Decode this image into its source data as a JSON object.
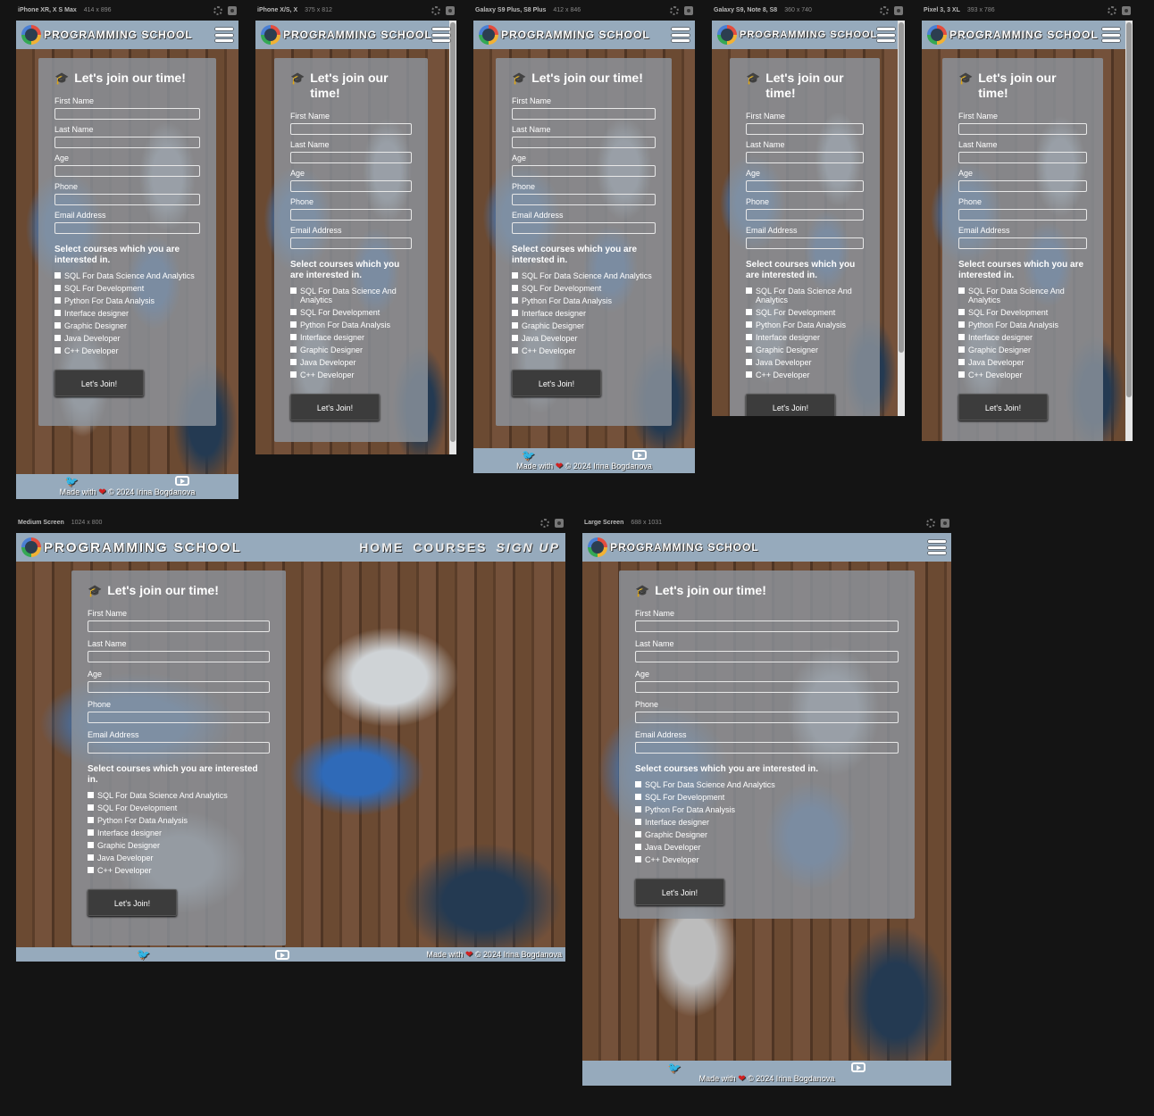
{
  "devices": [
    {
      "name": "iPhone XR, X S Max",
      "size": "414 x 896"
    },
    {
      "name": "iPhone X/S, X",
      "size": "375 x 812"
    },
    {
      "name": "Galaxy S9 Plus, S8 Plus",
      "size": "412 x 846"
    },
    {
      "name": "Galaxy S9, Note 8, S8",
      "size": "360 x 740"
    },
    {
      "name": "Pixel 3, 3 XL",
      "size": "393 x 786"
    },
    {
      "name": "Medium Screen",
      "size": "1024 x 800"
    },
    {
      "name": "Large Screen",
      "size": "688 x 1031"
    }
  ],
  "site": {
    "brand": "PROGRAMMING SCHOOL",
    "nav": {
      "home": "HOME",
      "courses": "COURSES",
      "signup": "SIGN UP"
    },
    "form": {
      "title": "Let's join our time!",
      "fields": [
        "First Name",
        "Last Name",
        "Age",
        "Phone",
        "Email Address"
      ],
      "courses_heading": "Select courses which you are interested in.",
      "courses": [
        "SQL For Data Science And Analytics",
        "SQL For Development",
        "Python For Data Analysis",
        "Interface designer",
        "Graphic Designer",
        "Java Developer",
        "C++ Developer"
      ],
      "submit": "Let's Join!"
    },
    "footer": {
      "made_with": "Made with",
      "copyright": "© 2024 Irina Bogdanova"
    }
  },
  "colors": {
    "header": "#96aabc",
    "card": "#8c949c",
    "button": "#3c3c3c",
    "page_bg": "#141414"
  },
  "icons": [
    "graduation-cap-icon",
    "hamburger-menu-icon",
    "twitter-icon",
    "youtube-icon",
    "heart-icon",
    "logo-icon",
    "settings-icon",
    "camera-icon"
  ]
}
